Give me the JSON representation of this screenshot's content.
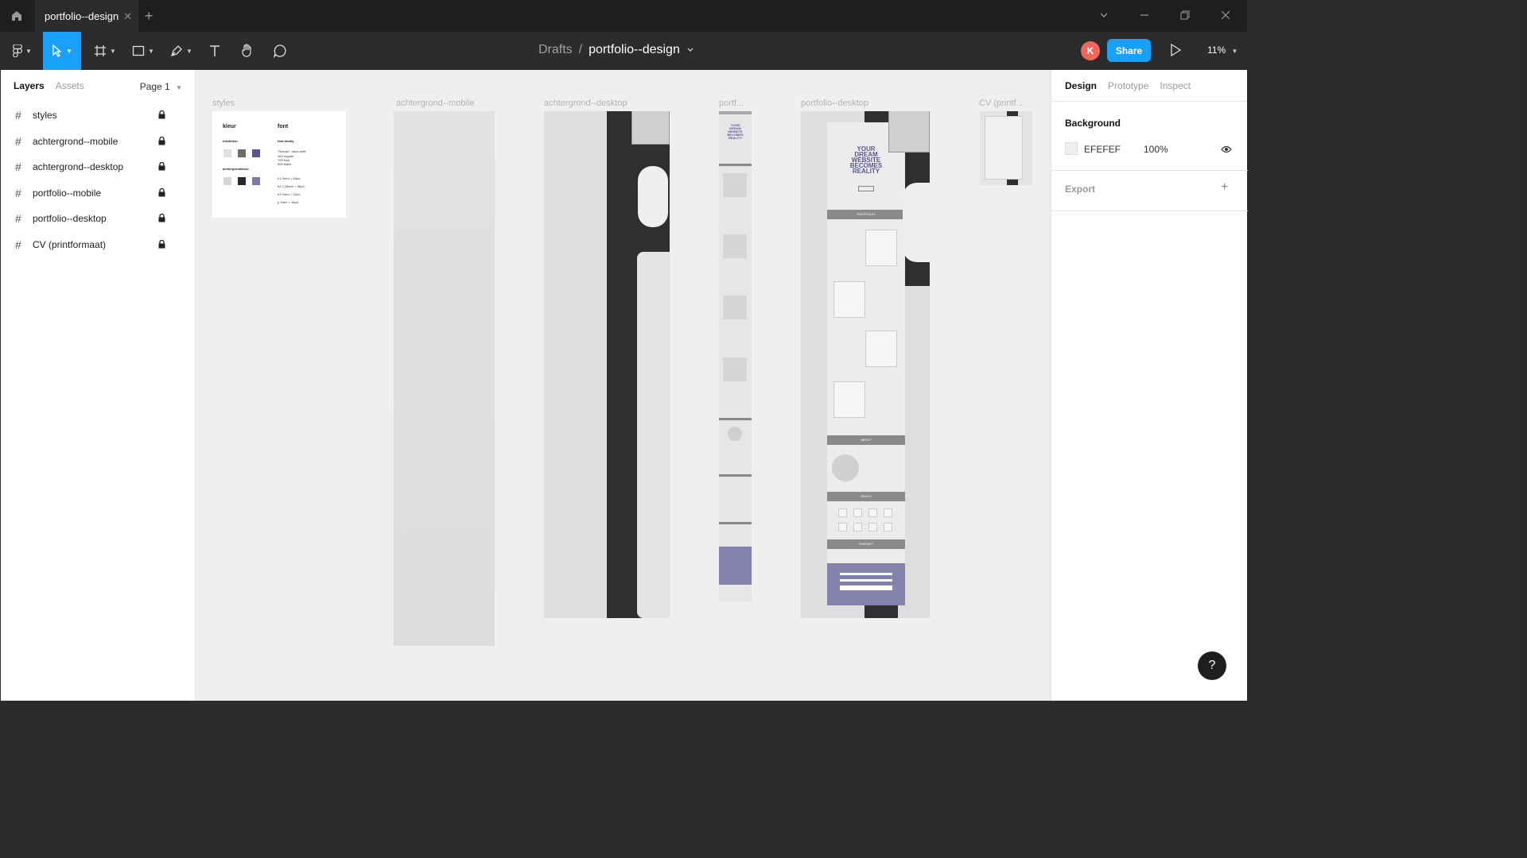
{
  "window": {
    "tab_title": "portfolio--design",
    "tab_close": "✕",
    "add_tab": "+"
  },
  "breadcrumb": {
    "drafts": "Drafts",
    "separator": "/",
    "file": "portfolio--design"
  },
  "toolbar": {
    "avatar_initial": "K",
    "share_label": "Share",
    "zoom": "11%",
    "active_tool": "move"
  },
  "left_panel": {
    "tabs": [
      "Layers",
      "Assets"
    ],
    "active_tab": "Layers",
    "page": "Page 1",
    "layers": [
      {
        "name": "styles",
        "locked": true
      },
      {
        "name": "achtergrond--mobile",
        "locked": true
      },
      {
        "name": "achtergrond--desktop",
        "locked": true
      },
      {
        "name": "portfolio--mobile",
        "locked": true
      },
      {
        "name": "portfolio--desktop",
        "locked": true
      },
      {
        "name": "CV (printformaat)",
        "locked": true
      }
    ]
  },
  "canvas": {
    "background": "#EFEFEF",
    "frame_labels": {
      "styles": "styles",
      "ach_mobile": "achtergrond--mobile",
      "ach_desktop": "achtergrond--desktop",
      "port_mobile": "portf...",
      "port_desktop": "portfolio--desktop",
      "cv": "CV (printf..."
    },
    "styles_frame": {
      "kleur": "kleur",
      "tekstkleur": "tekstkleur",
      "achtergrondkleur": "achtergrondkleur",
      "font": "font",
      "font_family": "font-family",
      "font_desc": "\"Roboto\", sans-serif;",
      "weights": [
        "400 regular",
        "700 bold",
        "900 black"
      ],
      "sizes": [
        "h1   3rem = 48px;",
        "h2   2.25rem = 36px;",
        "h3   2rem = 32px;",
        "p    1rem = 16px;"
      ],
      "text_colors": [
        "#e0e0e0",
        "#6b6b6b",
        "#5a5590"
      ],
      "bg_colors": [
        "#d6d6d6",
        "#2a2a2a",
        "#7f79aa"
      ]
    },
    "hero_text": [
      "YOUR",
      "DREAM",
      "WEBSITE",
      "BECOMES",
      "REALITY"
    ],
    "section_labels": [
      "PORTFOLIO",
      "ABOUT",
      "SKILLS",
      "CONTACT"
    ],
    "accent": "#5a5590"
  },
  "right_panel": {
    "tabs": [
      "Design",
      "Prototype",
      "Inspect"
    ],
    "active_tab": "Design",
    "background_title": "Background",
    "background_hex": "EFEFEF",
    "background_opacity": "100%",
    "export_title": "Export",
    "export_add": "+"
  },
  "help_label": "?"
}
